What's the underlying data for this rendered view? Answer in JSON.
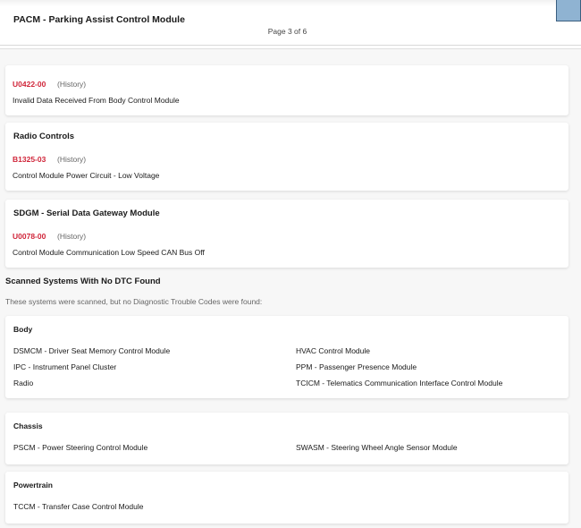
{
  "header": {
    "module_title": "PACM - Parking Assist Control Module",
    "page_indicator": "Page 3 of 6"
  },
  "dtc_cards": [
    {
      "title": "",
      "code": "U0422-00",
      "status": "(History)",
      "description": "Invalid Data Received From Body Control Module"
    },
    {
      "title": "Radio Controls",
      "code": "B1325-03",
      "status": "(History)",
      "description": "Control Module Power Circuit - Low Voltage"
    },
    {
      "title": "SDGM - Serial Data Gateway Module",
      "code": "U0078-00",
      "status": "(History)",
      "description": "Control Module Communication Low Speed CAN Bus Off"
    }
  ],
  "no_dtc": {
    "heading": "Scanned Systems With No DTC Found",
    "subtitle": "These systems were scanned, but no Diagnostic Trouble Codes were found:",
    "categories": [
      {
        "title": "Body",
        "left": [
          "DSMCM - Driver Seat Memory Control Module",
          "IPC - Instrument Panel Cluster",
          "Radio"
        ],
        "right": [
          "HVAC Control Module",
          "PPM - Passenger Presence Module",
          "TCICM - Telematics Communication Interface Control Module"
        ]
      },
      {
        "title": "Chassis",
        "left": [
          "PSCM - Power Steering Control Module"
        ],
        "right": [
          "SWASM - Steering Wheel Angle Sensor Module"
        ]
      },
      {
        "title": "Powertrain",
        "left": [
          "TCCM - Transfer Case Control Module"
        ],
        "right": []
      }
    ]
  },
  "colors": {
    "dtc_code": "#d0263a",
    "muted_text": "#666666",
    "card_background": "#ffffff",
    "page_background": "#f7f7f7"
  }
}
